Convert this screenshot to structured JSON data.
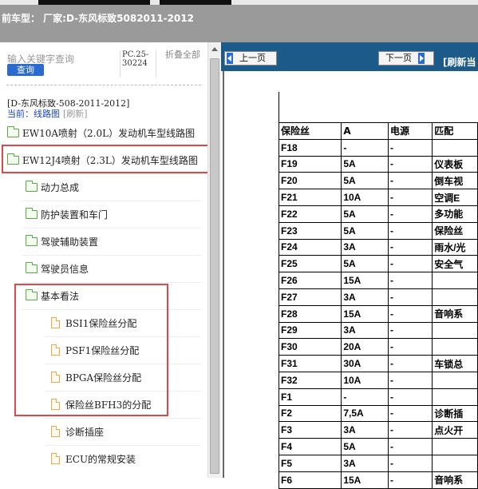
{
  "header": {
    "title": "前车型：  厂家:D-东风标致5082011-2012"
  },
  "sidebar": {
    "search_placeholder": "输入关键字查询",
    "query_label": "查询",
    "pc_code": "PC.25-30224",
    "fold_all": "折叠全部",
    "breadcrumb_model": "[D-东风标致-508-2011-2012]",
    "breadcrumb_current": "当前：线路图",
    "breadcrumb_refresh": "[刷新]",
    "items": [
      {
        "label": "EW10A喷射（2.0L）发动机车型线路图"
      },
      {
        "label": "EW12J4喷射（2.3L）发动机车型线路图"
      },
      {
        "label": "动力总成"
      },
      {
        "label": "防护装置和车门"
      },
      {
        "label": "驾驶辅助装置"
      },
      {
        "label": "驾驶员信息"
      },
      {
        "label": "基本看法"
      },
      {
        "label": "BSI1保险丝分配"
      },
      {
        "label": "PSF1保险丝分配"
      },
      {
        "label": "BPGA保险丝分配"
      },
      {
        "label": "保险丝BFH3的分配"
      },
      {
        "label": "诊断插座"
      },
      {
        "label": "ECU的常规安装"
      }
    ]
  },
  "toolbar": {
    "prev_label": "上一页",
    "next_label": "下一页",
    "refresh_current": "[刷新当"
  },
  "fuse_table": {
    "headers": [
      "保险丝",
      "A",
      "电源",
      "匹配"
    ],
    "rows": [
      [
        "F18",
        "-",
        "-",
        ""
      ],
      [
        "F19",
        "5A",
        "-",
        "仪表板"
      ],
      [
        "F20",
        "5A",
        "-",
        "倒车视"
      ],
      [
        "F21",
        "10A",
        "-",
        "空调E"
      ],
      [
        "F22",
        "5A",
        "-",
        "多功能"
      ],
      [
        "F23",
        "5A",
        "-",
        "保险丝"
      ],
      [
        "F24",
        "3A",
        "-",
        "雨水/光"
      ],
      [
        "F25",
        "5A",
        "-",
        "安全气"
      ],
      [
        "F26",
        "15A",
        "-",
        ""
      ],
      [
        "F27",
        "3A",
        "-",
        ""
      ],
      [
        "F28",
        "15A",
        "-",
        "音响系"
      ],
      [
        "F29",
        "3A",
        "-",
        ""
      ],
      [
        "F30",
        "20A",
        "-",
        ""
      ],
      [
        "F31",
        "30A",
        "-",
        "车锁总"
      ],
      [
        "F32",
        "10A",
        "-",
        ""
      ],
      [
        "F1",
        "-",
        "-",
        ""
      ],
      [
        "F2",
        "7,5A",
        "-",
        "诊断插"
      ],
      [
        "F3",
        "3A",
        "-",
        "点火开"
      ],
      [
        "F4",
        "5A",
        "-",
        ""
      ],
      [
        "F5",
        "3A",
        "-",
        ""
      ],
      [
        "F6",
        "15A",
        "-",
        "音响系"
      ]
    ]
  },
  "colors": {
    "header_bg": "#9a9a9a",
    "toolbar_bg": "#1c5a8a",
    "highlight_border": "#e04848",
    "query_button": "#2a6bd0",
    "folder_icon": "#58a94a",
    "doc_icon": "#e8a94a"
  }
}
